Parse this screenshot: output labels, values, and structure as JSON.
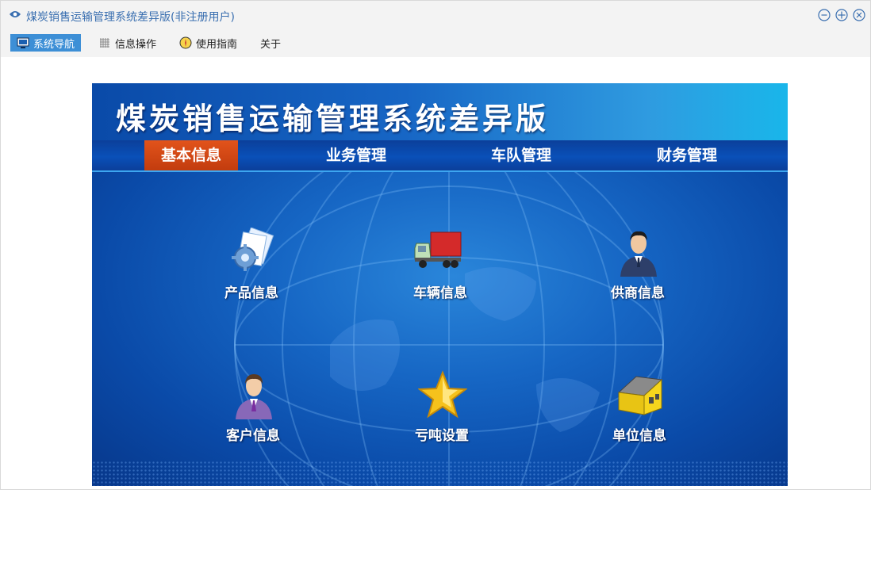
{
  "window": {
    "title": "煤炭销售运输管理系统差异版(非注册用户)"
  },
  "menu": {
    "items": [
      {
        "label": "系统导航",
        "icon": "monitor-icon",
        "active": true
      },
      {
        "label": "信息操作",
        "icon": "grid-icon",
        "active": false
      },
      {
        "label": "使用指南",
        "icon": "guide-icon",
        "active": false
      },
      {
        "label": "关于",
        "icon": "",
        "active": false
      }
    ]
  },
  "banner": {
    "title": "煤炭销售运输管理系统差异版",
    "tabs": [
      {
        "label": "基本信息",
        "active": true
      },
      {
        "label": "业务管理",
        "active": false
      },
      {
        "label": "车队管理",
        "active": false
      },
      {
        "label": "财务管理",
        "active": false
      }
    ],
    "tiles": [
      {
        "label": "产品信息",
        "icon": "gear-document-icon"
      },
      {
        "label": "车辆信息",
        "icon": "truck-icon"
      },
      {
        "label": "供商信息",
        "icon": "supplier-person-icon"
      },
      {
        "label": "客户信息",
        "icon": "customer-person-icon"
      },
      {
        "label": "亏吨设置",
        "icon": "star-icon"
      },
      {
        "label": "单位信息",
        "icon": "house-icon"
      }
    ]
  },
  "colors": {
    "accent": "#3d8fd6",
    "title_text": "#3a6fb0",
    "active_tab": "#d24716",
    "banner_blue": "#0a4aa8"
  }
}
